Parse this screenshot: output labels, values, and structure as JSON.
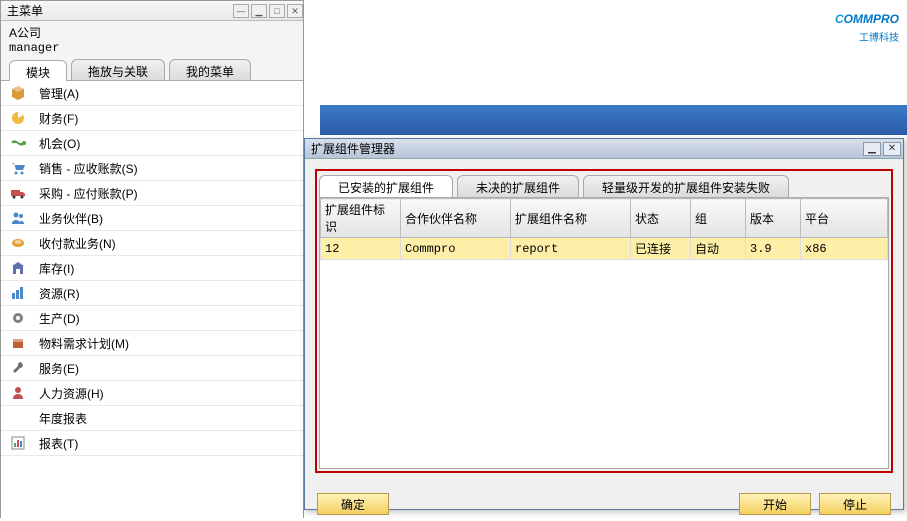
{
  "mainMenu": {
    "title": "主菜单",
    "company": "A公司",
    "user": "manager",
    "tabs": [
      "模块",
      "拖放与关联",
      "我的菜单"
    ],
    "activeTab": 0,
    "items": [
      {
        "icon": "cube",
        "label": "管理(A)"
      },
      {
        "icon": "pie",
        "label": "财务(F)"
      },
      {
        "icon": "flow",
        "label": "机会(O)"
      },
      {
        "icon": "cart",
        "label": "销售 - 应收账款(S)"
      },
      {
        "icon": "truck",
        "label": "采购 - 应付账款(P)"
      },
      {
        "icon": "people",
        "label": "业务伙伴(B)"
      },
      {
        "icon": "coin",
        "label": "收付款业务(N)"
      },
      {
        "icon": "store",
        "label": "库存(I)"
      },
      {
        "icon": "bars",
        "label": "资源(R)"
      },
      {
        "icon": "gear",
        "label": "生产(D)"
      },
      {
        "icon": "pkg",
        "label": "物料需求计划(M)"
      },
      {
        "icon": "wrench",
        "label": "服务(E)"
      },
      {
        "icon": "person",
        "label": "人力资源(H)"
      },
      {
        "icon": "",
        "label": "年度报表"
      },
      {
        "icon": "chart",
        "label": "报表(T)"
      }
    ]
  },
  "logo": {
    "main": "OMMPRO",
    "prefix": "C",
    "sub": "工博科技"
  },
  "dialog": {
    "title": "扩展组件管理器",
    "tabs": [
      "已安装的扩展组件",
      "未决的扩展组件",
      "轻量级开发的扩展组件安装失败"
    ],
    "activeTab": 0,
    "columns": [
      "扩展组件标识",
      "合作伙伴名称",
      "扩展组件名称",
      "状态",
      "组",
      "版本",
      "平台"
    ],
    "rows": [
      {
        "id": "12",
        "partner": "Commpro",
        "name": "report",
        "status": "已连接",
        "group": "自动",
        "version": "3.9",
        "platform": "x86"
      }
    ],
    "buttons": {
      "ok": "确定",
      "start": "开始",
      "stop": "停止"
    }
  }
}
